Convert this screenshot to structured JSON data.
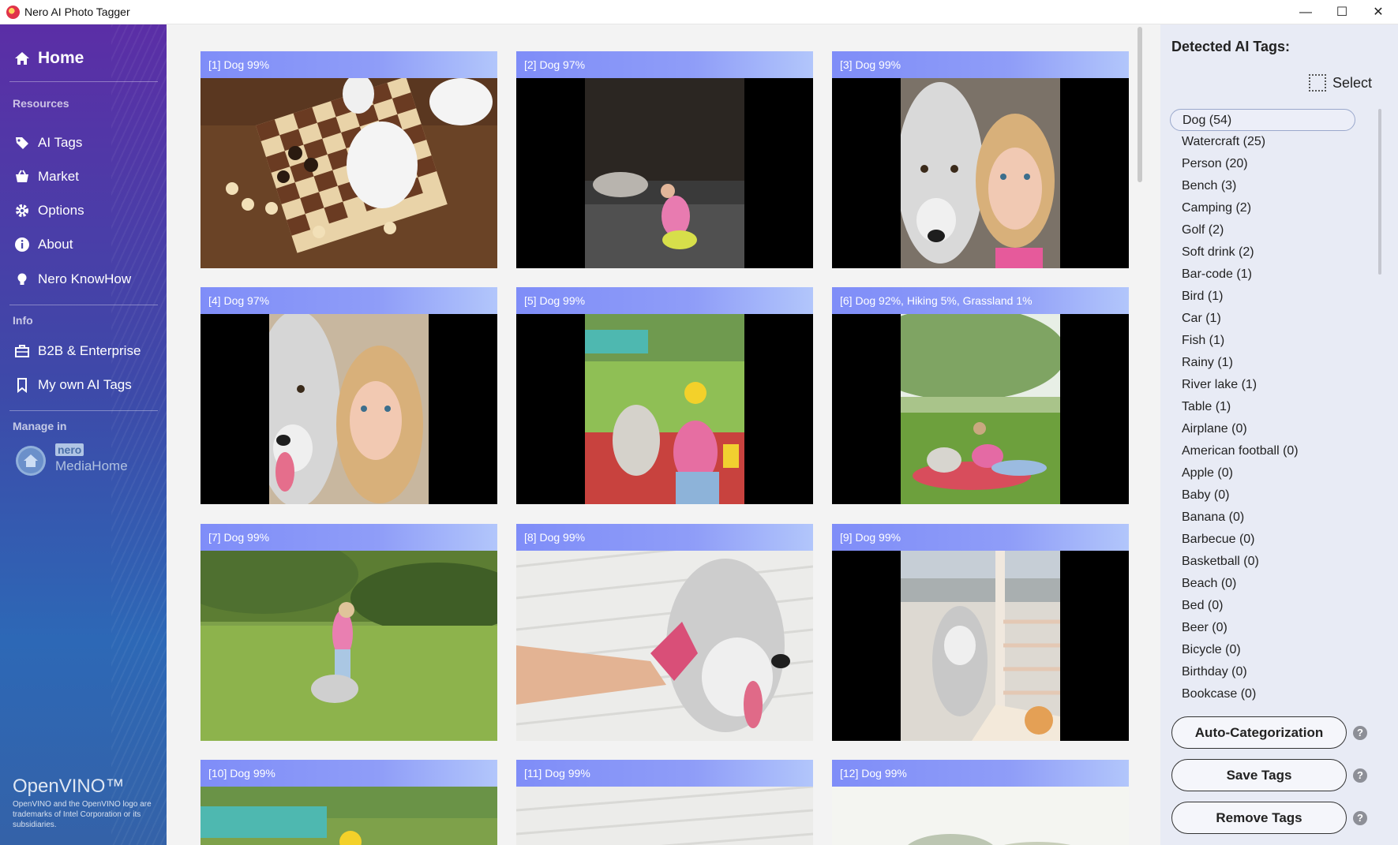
{
  "window": {
    "title": "Nero AI Photo Tagger",
    "minimize": "—",
    "maximize": "☐",
    "close": "✕"
  },
  "sidebar": {
    "home": "Home",
    "resources_title": "Resources",
    "resources": [
      "AI Tags",
      "Market",
      "Options",
      "About",
      "Nero KnowHow"
    ],
    "info_title": "Info",
    "info": [
      "B2B & Enterprise",
      "My own AI Tags"
    ],
    "manage_title": "Manage in",
    "mediahome_brand": "nero",
    "mediahome_label": "MediaHome",
    "openvino_logo": "OpenVINO™",
    "openvino_legal": "OpenVINO and the OpenVINO logo are trademarks of Intel Corporation or its subsidiaries."
  },
  "photos": [
    "[1] Dog 99%",
    "[2] Dog 97%",
    "[3] Dog 99%",
    "[4] Dog 97%",
    "[5] Dog 99%",
    "[6] Dog 92%, Hiking 5%, Grassland 1%",
    "[7] Dog 99%",
    "[8] Dog 99%",
    "[9] Dog 99%",
    "[10] Dog 99%",
    "[11] Dog 99%",
    "[12] Dog 99%"
  ],
  "panel": {
    "title": "Detected AI Tags:",
    "select_label": "Select",
    "tags": [
      "Dog (54)",
      "Watercraft (25)",
      "Person (20)",
      "Bench (3)",
      "Camping (2)",
      "Golf (2)",
      "Soft drink (2)",
      "Bar-code (1)",
      "Bird (1)",
      "Car (1)",
      "Fish (1)",
      "Rainy (1)",
      "River lake (1)",
      "Table (1)",
      "Airplane (0)",
      "American football (0)",
      "Apple (0)",
      "Baby (0)",
      "Banana (0)",
      "Barbecue (0)",
      "Basketball (0)",
      "Beach (0)",
      "Bed (0)",
      "Beer (0)",
      "Bicycle (0)",
      "Birthday (0)",
      "Bookcase (0)"
    ],
    "selected_tag": "Dog (54)",
    "auto_categorization": "Auto-Categorization",
    "save_tags": "Save Tags",
    "remove_tags": "Remove Tags",
    "help": "?"
  }
}
